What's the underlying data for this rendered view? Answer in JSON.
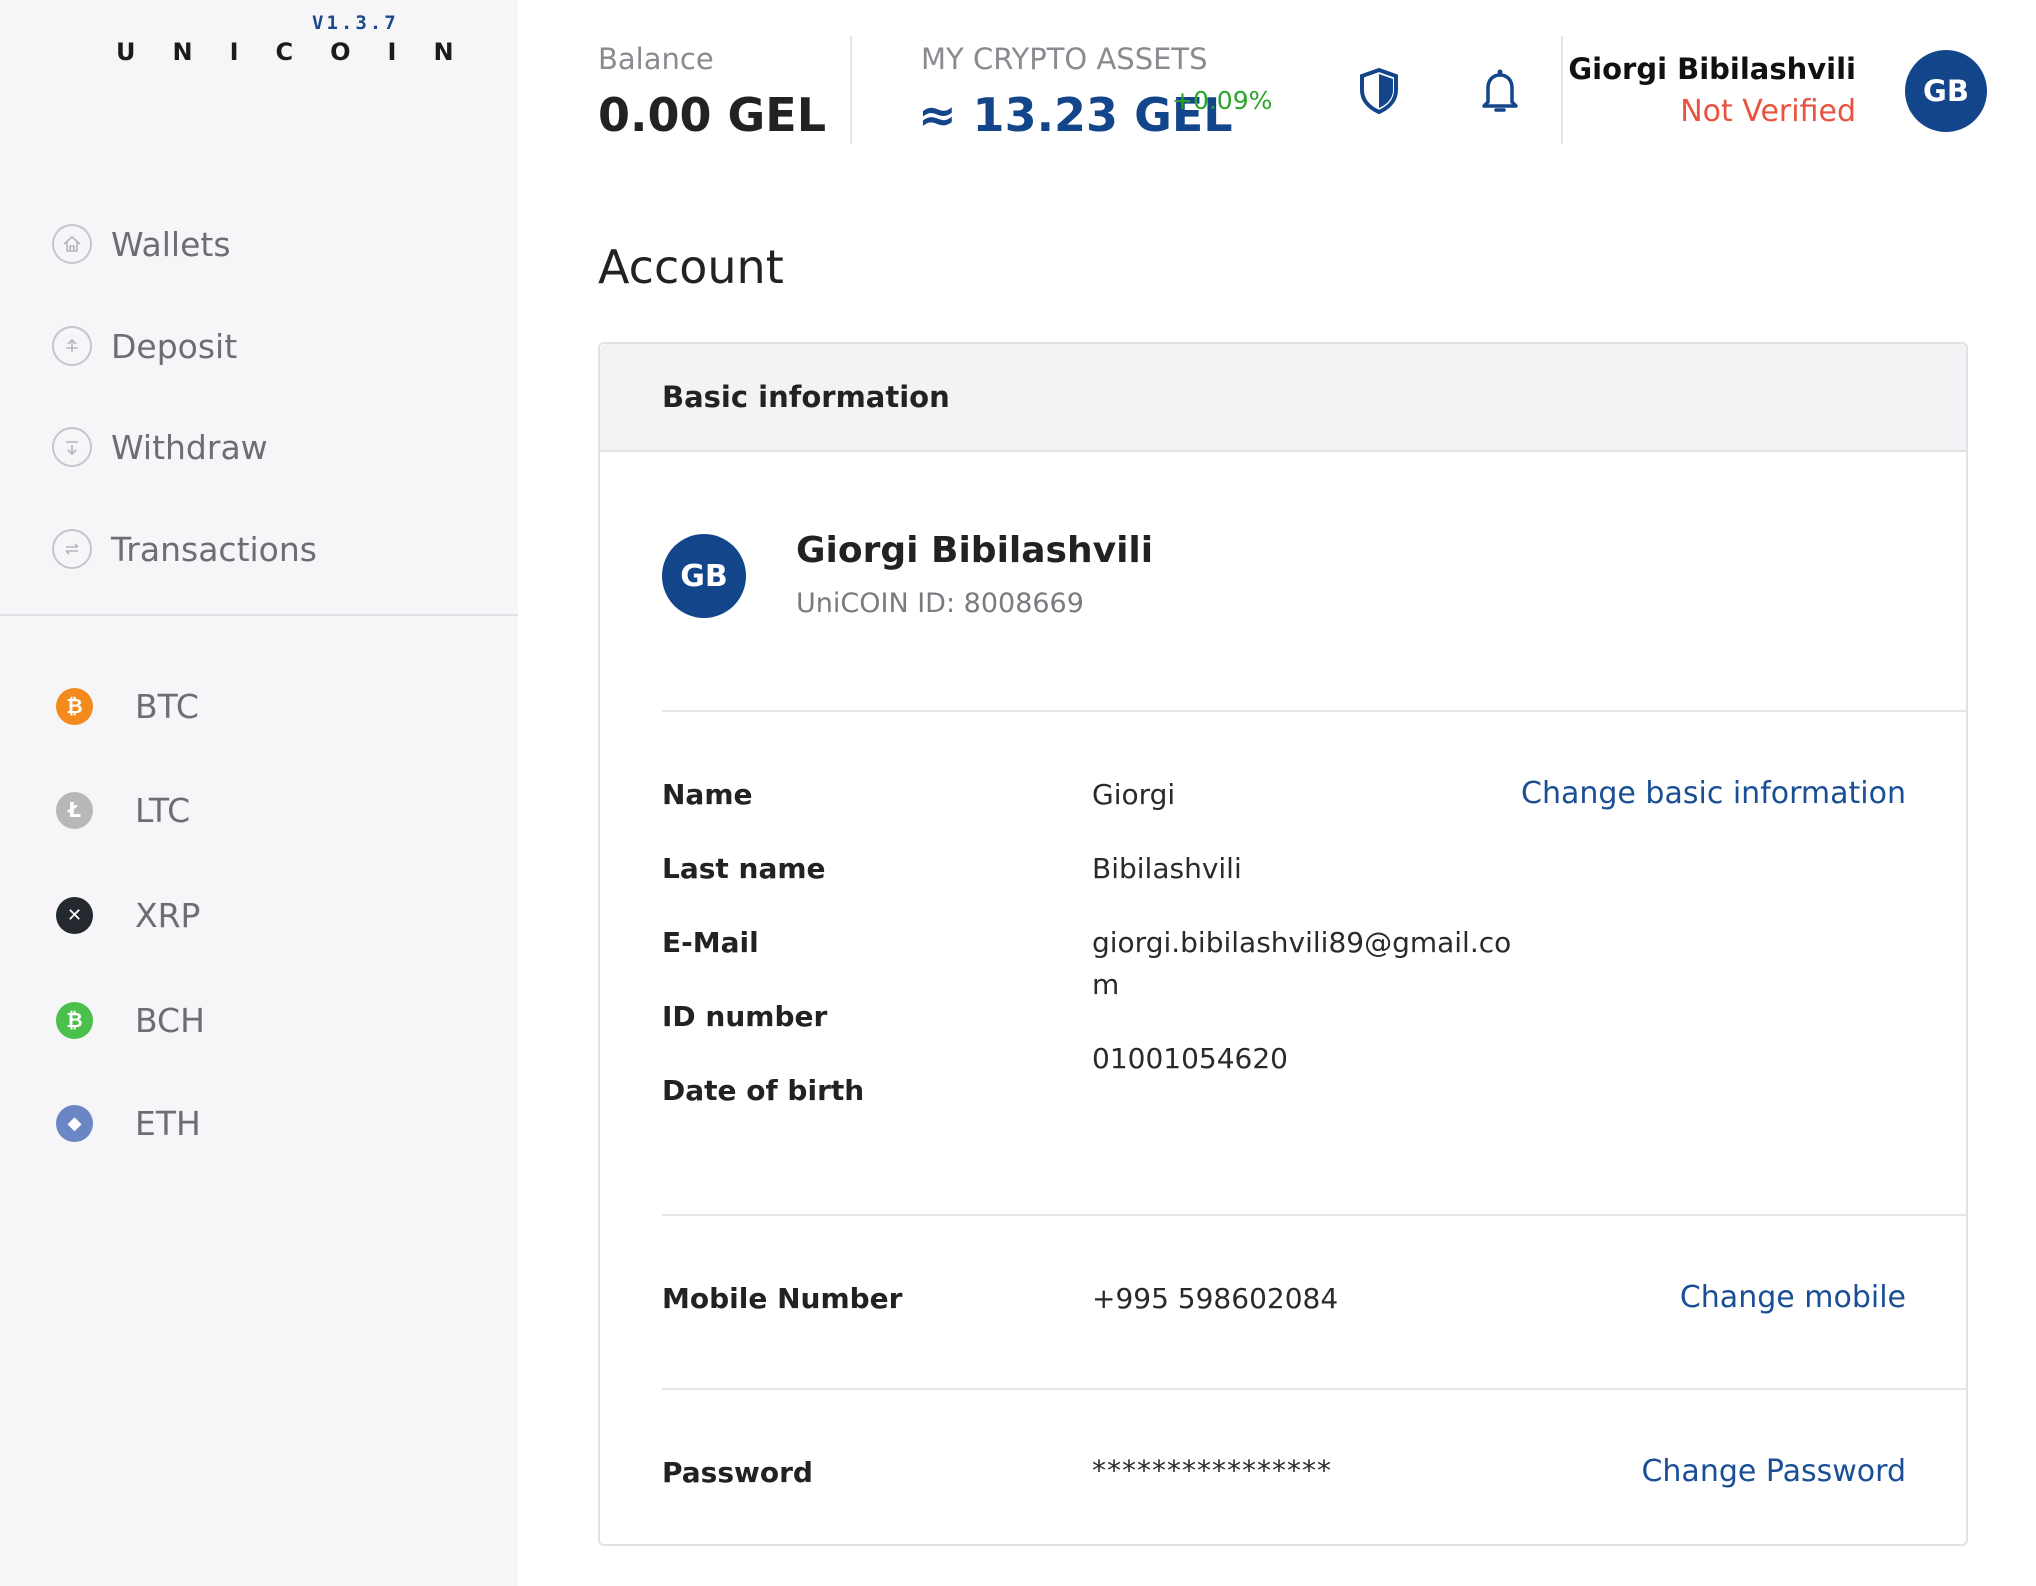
{
  "app": {
    "logo": "UNICOIN",
    "version": "V1.3.7"
  },
  "sidebar": {
    "nav": [
      {
        "label": "Wallets",
        "icon": "home-icon"
      },
      {
        "label": "Deposit",
        "icon": "deposit-icon"
      },
      {
        "label": "Withdraw",
        "icon": "withdraw-icon"
      },
      {
        "label": "Transactions",
        "icon": "transactions-icon"
      }
    ],
    "coins": [
      {
        "label": "BTC",
        "icon": "bitcoin-icon",
        "color": "#f28a1e",
        "glyph": "₿"
      },
      {
        "label": "LTC",
        "icon": "litecoin-icon",
        "color": "#b8b8b8",
        "glyph": "Ł"
      },
      {
        "label": "XRP",
        "icon": "ripple-icon",
        "color": "#23292f",
        "glyph": "✕"
      },
      {
        "label": "BCH",
        "icon": "bitcoin-cash-icon",
        "color": "#4cc04c",
        "glyph": "₿"
      },
      {
        "label": "ETH",
        "icon": "ethereum-icon",
        "color": "#6b86c4",
        "glyph": "◆"
      }
    ]
  },
  "header": {
    "balance_label": "Balance",
    "balance_value": "0.00 GEL",
    "assets_label": "MY CRYPTO ASSETS",
    "assets_value": "≈ 13.23 GEL",
    "assets_change": "+0.09%",
    "user_name": "Giorgi Bibilashvili",
    "user_status": "Not Verified",
    "avatar_initials": "GB",
    "shield_icon": "shield-icon",
    "bell_icon": "bell-icon"
  },
  "main": {
    "title": "Account",
    "card": {
      "title": "Basic information",
      "profile_initials": "GB",
      "profile_name": "Giorgi Bibilashvili",
      "profile_id": "UniCOIN ID: 8008669",
      "fields": {
        "name_label": "Name",
        "name_value": "Giorgi",
        "lastname_label": "Last name",
        "lastname_value": "Bibilashvili",
        "email_label": "E-Mail",
        "email_value_line1": "giorgi.bibilashvili89@gmail.co",
        "email_value_line2": "m",
        "id_label": "ID number",
        "id_value": "01001054620",
        "dob_label": "Date of birth"
      },
      "change_basic_label": "Change basic information",
      "mobile_label": "Mobile Number",
      "mobile_value": "+995 598602084",
      "change_mobile_label": "Change mobile",
      "password_label": "Password",
      "password_value": "****************",
      "change_password_label": "Change Password"
    }
  },
  "colors": {
    "brand_blue": "#13458a",
    "link_blue": "#1a4f96",
    "positive_green": "#2aa52a",
    "warning_red": "#e8523f"
  }
}
